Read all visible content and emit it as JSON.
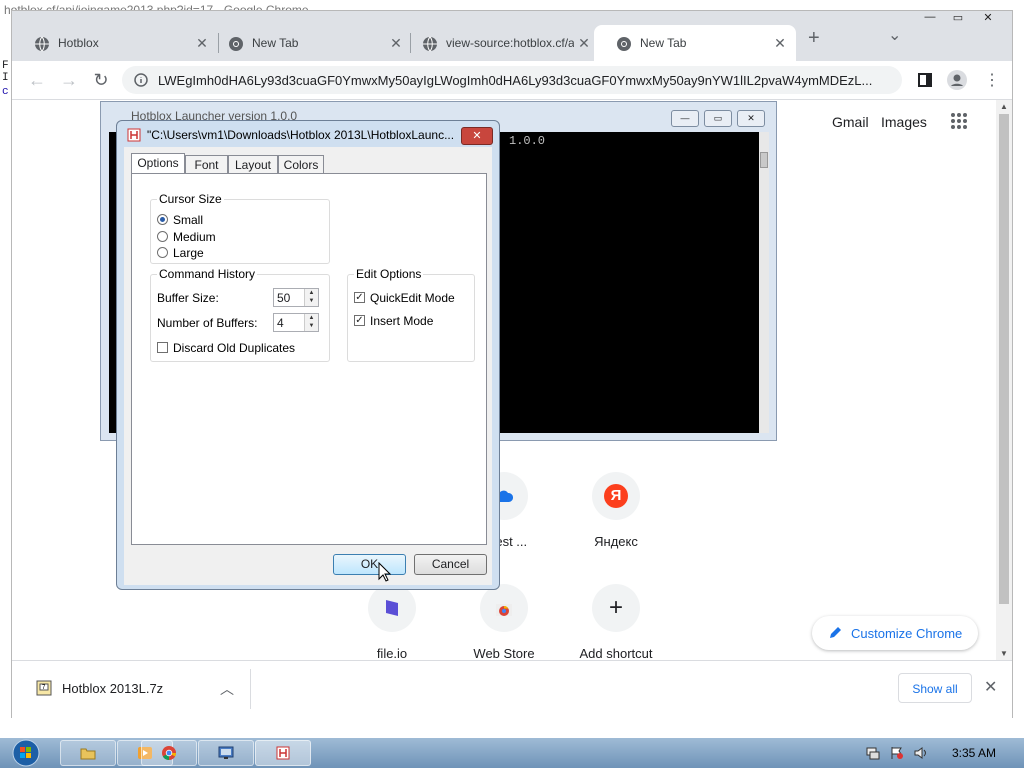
{
  "background": {
    "window_title": "hotblox.cf/api/joingame2013.php?id=17 - Google Chrome",
    "left_strip_text": [
      "F",
      "I",
      "c"
    ]
  },
  "browser": {
    "tabs": [
      {
        "label": "Hotblox",
        "icon": "globe-icon",
        "active": false
      },
      {
        "label": "New Tab",
        "icon": "chrome-icon",
        "active": false
      },
      {
        "label": "view-source:hotblox.cf/a",
        "icon": "globe-icon",
        "active": false
      },
      {
        "label": "New Tab",
        "icon": "chrome-icon",
        "active": true
      }
    ],
    "new_tab_symbol": "+",
    "tab_search_symbol": "⌄",
    "address": "LWEgImh0dHA6Ly93d3cuaGF0YmwxMy50ayIgLWogImh0dHA6Ly93d3cuaGF0YmwxMy50ay9nYW1lIL2pvaW4ymMDEzL...",
    "window_controls": {
      "minimize": "—",
      "restore": "▭",
      "close": "✕"
    }
  },
  "new_tab_page": {
    "top_links": {
      "gmail": "Gmail",
      "images": "Images"
    },
    "shortcuts_row1": [
      {
        "label": "quest ...",
        "icon": "cloud-icon"
      },
      {
        "label": "Яндекс",
        "icon": "yandex-icon",
        "glyph": "Я"
      }
    ],
    "shortcuts_row2": [
      {
        "label": "file.io",
        "icon": "file-io-icon"
      },
      {
        "label": "Web Store",
        "icon": "web-store-icon"
      },
      {
        "label": "Add shortcut",
        "icon": "plus-icon",
        "glyph": "+"
      }
    ],
    "customize_label": "Customize Chrome"
  },
  "downloads": {
    "file_name": "Hotblox 2013L.7z",
    "show_all": "Show all",
    "close_symbol": "✕"
  },
  "console": {
    "title": "Hotblox Launcher version 1.0.0",
    "visible_text": "1.0.0"
  },
  "dialog": {
    "title": "\"C:\\Users\\vm1\\Downloads\\Hotblox 2013L\\HotbloxLaunc...",
    "close_symbol": "✕",
    "tabs": [
      "Options",
      "Font",
      "Layout",
      "Colors"
    ],
    "active_tab": "Options",
    "cursor_size": {
      "title": "Cursor Size",
      "options": [
        "Small",
        "Medium",
        "Large"
      ],
      "selected": "Small"
    },
    "command_history": {
      "title": "Command History",
      "buffer_size_label": "Buffer Size:",
      "buffer_size_value": "50",
      "num_buffers_label": "Number of Buffers:",
      "num_buffers_value": "4",
      "discard_label": "Discard Old Duplicates",
      "discard_checked": false
    },
    "edit_options": {
      "title": "Edit Options",
      "quickedit_label": "QuickEdit Mode",
      "quickedit_checked": true,
      "insert_label": "Insert Mode",
      "insert_checked": true
    },
    "ok_label": "OK",
    "cancel_label": "Cancel"
  },
  "taskbar": {
    "time": "3:35 AM",
    "apps": [
      "explorer-icon",
      "media-player-icon",
      "chrome-icon",
      "remote-desktop-icon",
      "hotblox-icon"
    ]
  },
  "colors": {
    "accent_blue": "#1a73e8",
    "tab_strip": "#dee1e6",
    "dialog_frame": "#cfdff0",
    "close_red": "#c8463d"
  }
}
